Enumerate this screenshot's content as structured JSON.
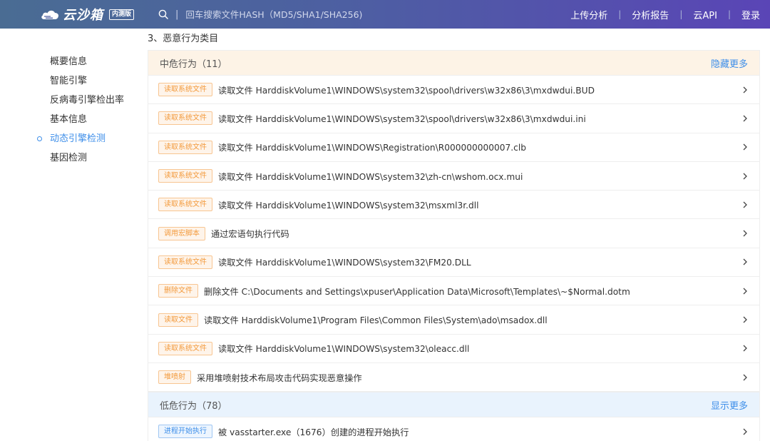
{
  "header": {
    "logo_text": "云沙箱",
    "logo_badge": "内测版",
    "search_placeholder": "回车搜索文件HASH（MD5/SHA1/SHA256)",
    "search_separator": "|",
    "nav": [
      "上传分析",
      "分析报告",
      "云API",
      "登录"
    ]
  },
  "sidebar": {
    "items": [
      {
        "label": "概要信息",
        "active": false
      },
      {
        "label": "智能引擎",
        "active": false
      },
      {
        "label": "反病毒引擎检出率",
        "active": false
      },
      {
        "label": "基本信息",
        "active": false
      },
      {
        "label": "动态引擎检测",
        "active": true
      },
      {
        "label": "基因检测",
        "active": false
      }
    ]
  },
  "main": {
    "section_title": "3、恶意行为类目",
    "mid_group": {
      "title": "中危行为（11）",
      "more": "隐藏更多",
      "rows": [
        {
          "tag": "读取系统文件",
          "text": "读取文件 HarddiskVolume1\\WINDOWS\\system32\\spool\\drivers\\w32x86\\3\\mxdwdui.BUD"
        },
        {
          "tag": "读取系统文件",
          "text": "读取文件 HarddiskVolume1\\WINDOWS\\system32\\spool\\drivers\\w32x86\\3\\mxdwdui.ini"
        },
        {
          "tag": "读取系统文件",
          "text": "读取文件 HarddiskVolume1\\WINDOWS\\Registration\\R000000000007.clb"
        },
        {
          "tag": "读取系统文件",
          "text": "读取文件 HarddiskVolume1\\WINDOWS\\system32\\zh-cn\\wshom.ocx.mui"
        },
        {
          "tag": "读取系统文件",
          "text": "读取文件 HarddiskVolume1\\WINDOWS\\system32\\msxml3r.dll"
        },
        {
          "tag": "调用宏脚本",
          "text": "通过宏语句执行代码"
        },
        {
          "tag": "读取系统文件",
          "text": "读取文件 HarddiskVolume1\\WINDOWS\\system32\\FM20.DLL"
        },
        {
          "tag": "删除文件",
          "text": "删除文件 C:\\Documents and Settings\\xpuser\\Application Data\\Microsoft\\Templates\\~$Normal.dotm"
        },
        {
          "tag": "读取文件",
          "text": "读取文件 HarddiskVolume1\\Program Files\\Common Files\\System\\ado\\msadox.dll"
        },
        {
          "tag": "读取系统文件",
          "text": "读取文件 HarddiskVolume1\\WINDOWS\\system32\\oleacc.dll"
        },
        {
          "tag": "堆喷射",
          "text": "采用堆喷射技术布局攻击代码实现恶意操作"
        }
      ]
    },
    "low_group": {
      "title": "低危行为（78）",
      "more": "显示更多",
      "rows": [
        {
          "tag": "进程开始执行",
          "text": "被 vasstarter.exe（1676）创建的进程开始执行"
        }
      ]
    }
  },
  "colors": {
    "accent": "#3d8ee9",
    "mid_header_bg": "#fdf3e6",
    "low_header_bg": "#e9f3fd",
    "tag_orange": "#f39a3c"
  },
  "icons": {
    "logo": "cloud-sandbox-icon",
    "search": "search-icon",
    "row_arrow": "chevron-right-icon"
  }
}
